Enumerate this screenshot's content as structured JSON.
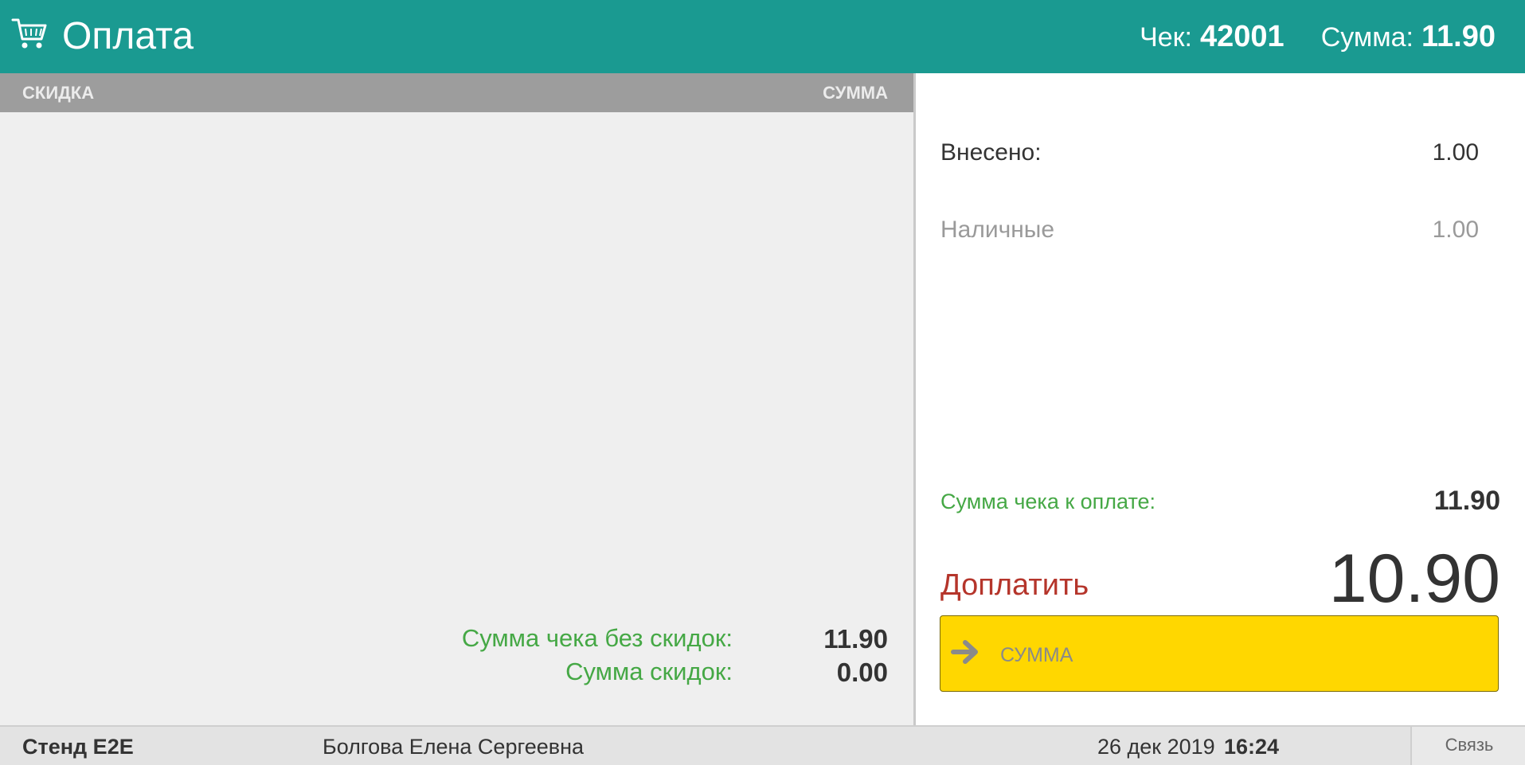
{
  "header": {
    "title": "Оплата",
    "cart_icon": "cart-icon",
    "check_label": "Чек:",
    "check_number": "42001",
    "sum_label": "Сумма:",
    "sum_value": "11.90",
    "background": "#1a9a91"
  },
  "discounts": {
    "columns": [
      "СКИДКА",
      "СУММА"
    ],
    "rows": [],
    "total_without_discounts_label": "Сумма чека без скидок:",
    "total_without_discounts_value": "11.90",
    "discounts_sum_label": "Сумма скидок:",
    "discounts_sum_value": "0.00"
  },
  "payment": {
    "paid_label": "Внесено:",
    "paid_value": "1.00",
    "methods": [
      {
        "label": "Наличные",
        "value": "1.00"
      }
    ],
    "due_label": "Сумма чека к оплате:",
    "due_value": "11.90",
    "to_pay_label": "Доплатить",
    "to_pay_value": "10.90",
    "sum_button_label": "СУММА",
    "sum_button_icon": "arrow-right-icon",
    "button_color": "#ffd700"
  },
  "status_bar": {
    "stand": "Стенд E2E",
    "user": "Болгова Елена Сергеевна",
    "date": "26 дек 2019",
    "time": "16:24",
    "connection": "Связь"
  }
}
